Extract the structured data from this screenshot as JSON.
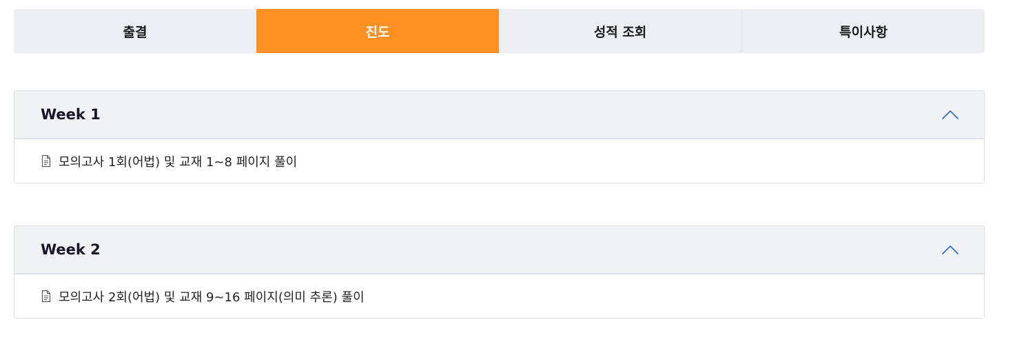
{
  "tabs": [
    {
      "label": "출결",
      "active": false
    },
    {
      "label": "진도",
      "active": true
    },
    {
      "label": "성적 조회",
      "active": false
    },
    {
      "label": "특이사항",
      "active": false
    }
  ],
  "colors": {
    "active_tab": "#ff9124",
    "chevron": "#2f6fd6"
  },
  "weeks": [
    {
      "title": "Week 1",
      "expanded": true,
      "icon": "document-icon",
      "content": "모의고사 1회(어법) 및 교재 1~8 페이지 풀이"
    },
    {
      "title": "Week 2",
      "expanded": true,
      "icon": "document-icon",
      "content": "모의고사 2회(어법) 및 교재 9~16 페이지(의미 추론) 풀이"
    }
  ]
}
